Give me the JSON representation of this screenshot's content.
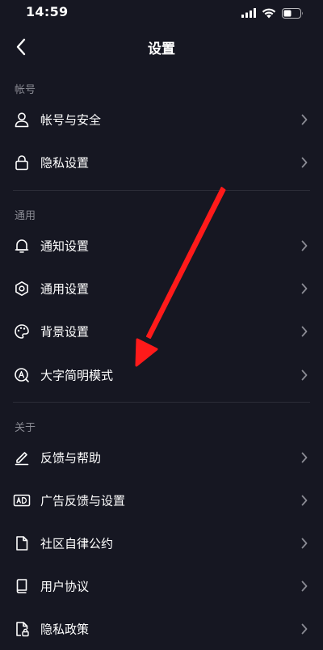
{
  "status": {
    "time": "14:59"
  },
  "header": {
    "title": "设置"
  },
  "sections": {
    "account": {
      "title": "帐号",
      "items": [
        {
          "label": "帐号与安全",
          "icon": "person-icon"
        },
        {
          "label": "隐私设置",
          "icon": "lock-icon"
        }
      ]
    },
    "general": {
      "title": "通用",
      "items": [
        {
          "label": "通知设置",
          "icon": "bell-icon"
        },
        {
          "label": "通用设置",
          "icon": "gear-icon"
        },
        {
          "label": "背景设置",
          "icon": "palette-icon"
        },
        {
          "label": "大字简明模式",
          "icon": "large-font-icon"
        }
      ]
    },
    "about": {
      "title": "关于",
      "items": [
        {
          "label": "反馈与帮助",
          "icon": "pen-icon"
        },
        {
          "label": "广告反馈与设置",
          "icon": "ad-icon"
        },
        {
          "label": "社区自律公约",
          "icon": "document-icon"
        },
        {
          "label": "用户协议",
          "icon": "book-icon"
        },
        {
          "label": "隐私政策",
          "icon": "privacy-doc-icon"
        }
      ]
    }
  },
  "colors": {
    "background": "#161722",
    "text": "#ffffff",
    "muted": "#8a8b94",
    "annotation": "#ff1a1a"
  }
}
